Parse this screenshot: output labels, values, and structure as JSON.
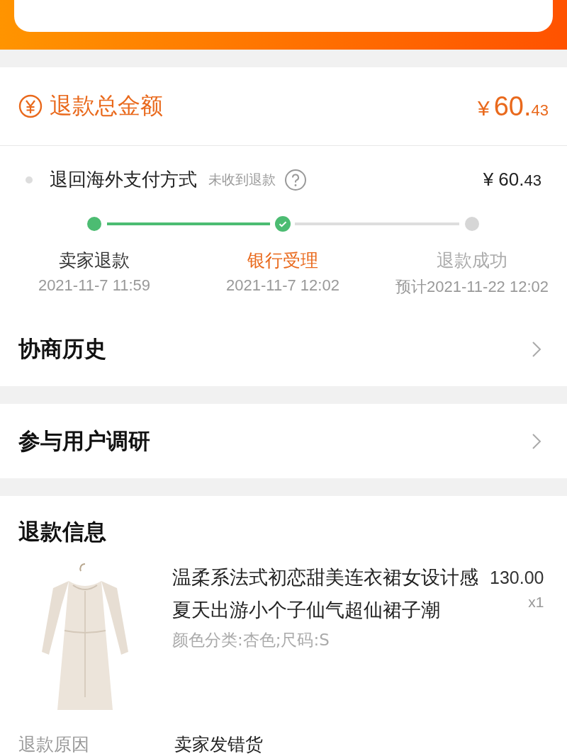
{
  "refund_total": {
    "label": "退款总金额",
    "currency": "¥",
    "amount": "60.",
    "cents": "43"
  },
  "refund_route": {
    "label": "退回海外支付方式",
    "note": "未收到退款",
    "currency": "¥",
    "amount": "60.",
    "cents": "43"
  },
  "steps": [
    {
      "label": "卖家退款",
      "time": "2021-11-7 11:59",
      "kind": "done"
    },
    {
      "label": "银行受理",
      "time": "2021-11-7 12:02",
      "kind": "current"
    },
    {
      "label": "退款成功",
      "time": "预计2021-11-22 12:02",
      "kind": "pending"
    }
  ],
  "links": [
    {
      "label": "协商历史"
    },
    {
      "label": "参与用户调研"
    }
  ],
  "refund_info": {
    "title": "退款信息",
    "product": {
      "name": "温柔系法式初恋甜美连衣裙女设计感夏天出游小个子仙气超仙裙子潮",
      "price": "130.00",
      "quantity": "x1",
      "spec": "颜色分类:杏色;尺码:S"
    },
    "rows": [
      {
        "label": "退款原因",
        "value": "卖家发错货"
      }
    ]
  }
}
